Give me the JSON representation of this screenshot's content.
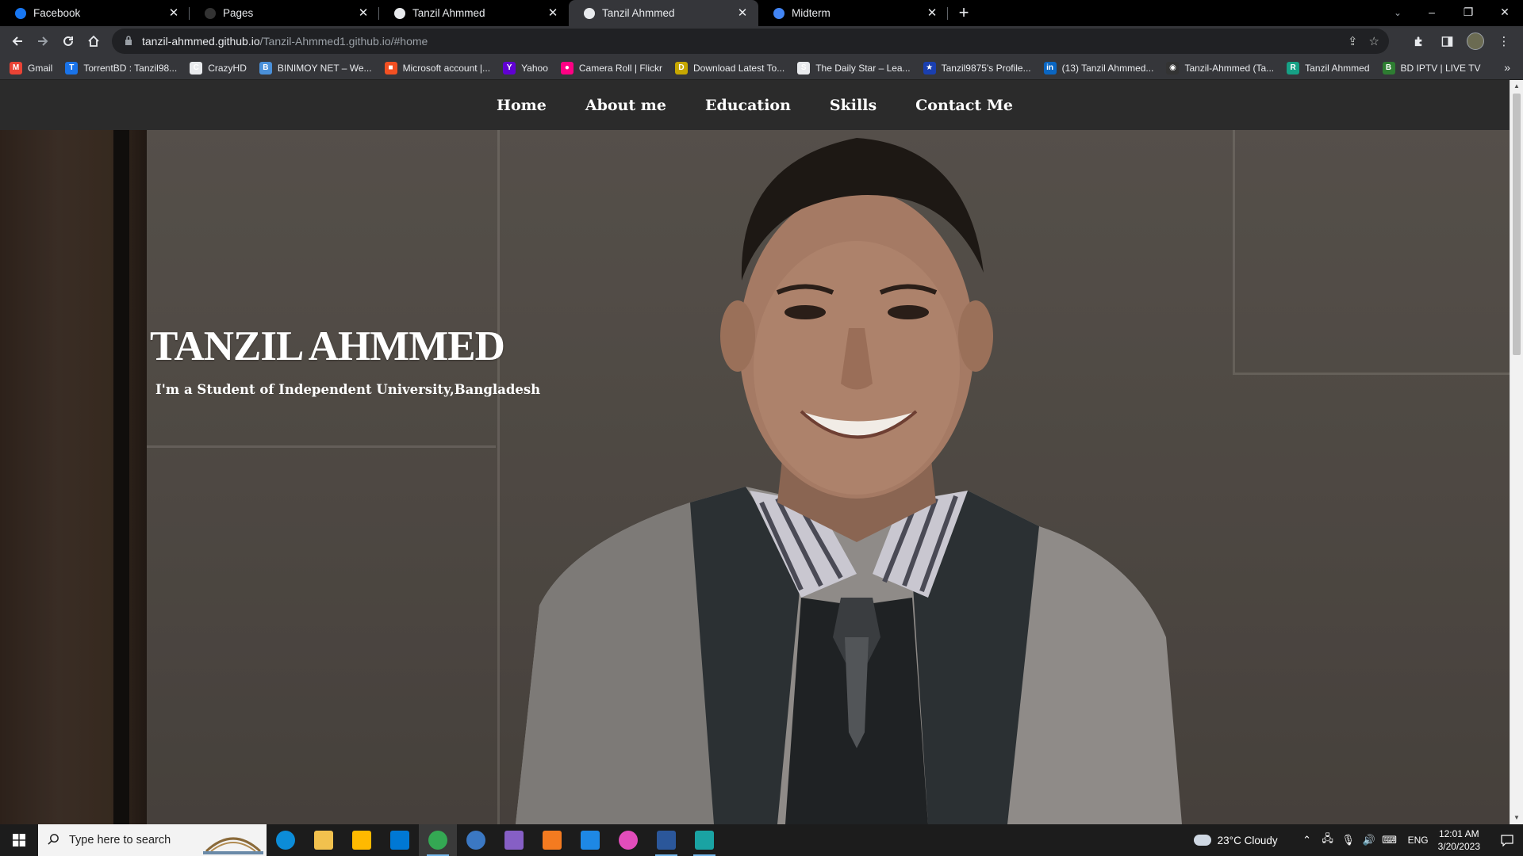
{
  "browser": {
    "tabs": [
      {
        "title": "Facebook",
        "icon": "facebook-icon",
        "color": "#1877f2",
        "active": false
      },
      {
        "title": "Pages",
        "icon": "github-icon",
        "color": "#333333",
        "active": false
      },
      {
        "title": "Tanzil Ahmmed",
        "icon": "globe-icon",
        "color": "#e8eaed",
        "active": false
      },
      {
        "title": "Tanzil Ahmmed",
        "icon": "globe-icon",
        "color": "#e8eaed",
        "active": true
      },
      {
        "title": "Midterm",
        "icon": "classroom-icon",
        "color": "#4285f4",
        "active": false
      }
    ],
    "new_tab_glyph": "+",
    "window_controls": {
      "tab_search": "⌄",
      "minimize": "–",
      "restore": "❐",
      "close": "✕"
    },
    "url_host": "tanzil-ahmmed.github.io",
    "url_path": "/Tanzil-Ahmmed1.github.io/#home",
    "bookmarks": [
      {
        "label": "Gmail",
        "icon": "gmail-icon",
        "color": "#ea4335",
        "glyph": "M"
      },
      {
        "label": "TorrentBD : Tanzil98...",
        "icon": "torrentbd-icon",
        "color": "#1a73e8",
        "glyph": "T"
      },
      {
        "label": "CrazyHD",
        "icon": "crazyhd-icon",
        "color": "#e8eaed",
        "glyph": "C"
      },
      {
        "label": "BINIMOY NET – We...",
        "icon": "binimoy-icon",
        "color": "#4a90d9",
        "glyph": "B"
      },
      {
        "label": "Microsoft account |...",
        "icon": "microsoft-icon",
        "color": "#f25022",
        "glyph": "■"
      },
      {
        "label": "Yahoo",
        "icon": "yahoo-icon",
        "color": "#6001d2",
        "glyph": "Y"
      },
      {
        "label": "Camera Roll | Flickr",
        "icon": "flickr-icon",
        "color": "#ff0084",
        "glyph": "●"
      },
      {
        "label": "Download Latest To...",
        "icon": "download-icon",
        "color": "#c6a700",
        "glyph": "D"
      },
      {
        "label": "The Daily Star – Lea...",
        "icon": "dailystar-icon",
        "color": "#e8eaed",
        "glyph": "S"
      },
      {
        "label": "Tanzil9875's Profile...",
        "icon": "star-icon",
        "color": "#1a3fb0",
        "glyph": "★"
      },
      {
        "label": "(13) Tanzil Ahmmed...",
        "icon": "linkedin-icon",
        "color": "#0a66c2",
        "glyph": "in"
      },
      {
        "label": "Tanzil-Ahmmed (Ta...",
        "icon": "github-icon",
        "color": "#333333",
        "glyph": "◉"
      },
      {
        "label": "Tanzil Ahmmed",
        "icon": "replit-icon",
        "color": "#16a085",
        "glyph": "R"
      },
      {
        "label": "BD IPTV | LIVE TV",
        "icon": "iptv-icon",
        "color": "#2e7d32",
        "glyph": "B"
      }
    ],
    "bookmarks_more": "»"
  },
  "site": {
    "nav": [
      "Home",
      "About me",
      "Education",
      "Skills",
      "Contact Me"
    ],
    "hero_title": "TANZIL AHMMED",
    "hero_subtitle": "I'm a Student of Independent University,Bangladesh"
  },
  "taskbar": {
    "search_placeholder": "Type here to search",
    "apps": [
      {
        "name": "edge-icon",
        "color": "#0c8cd8"
      },
      {
        "name": "file-explorer-icon",
        "color": "#f2c14e"
      },
      {
        "name": "store-icon",
        "color": "#ffb900"
      },
      {
        "name": "mail-icon",
        "color": "#0078d4"
      },
      {
        "name": "chrome-icon",
        "color": "#34a853",
        "active": true
      },
      {
        "name": "qbittorrent-icon",
        "color": "#3b78c3"
      },
      {
        "name": "visual-studio-icon",
        "color": "#865fc5"
      },
      {
        "name": "vlc-icon",
        "color": "#f47b20"
      },
      {
        "name": "app-blue-icon",
        "color": "#1e88e5"
      },
      {
        "name": "messenger-icon",
        "color": "#e24dbb"
      },
      {
        "name": "word-icon",
        "color": "#2b579a"
      },
      {
        "name": "image-app-icon",
        "color": "#1aa3a3"
      }
    ],
    "weather": "23°C  Cloudy",
    "language": "ENG",
    "time": "12:01 AM",
    "date": "3/20/2023"
  }
}
